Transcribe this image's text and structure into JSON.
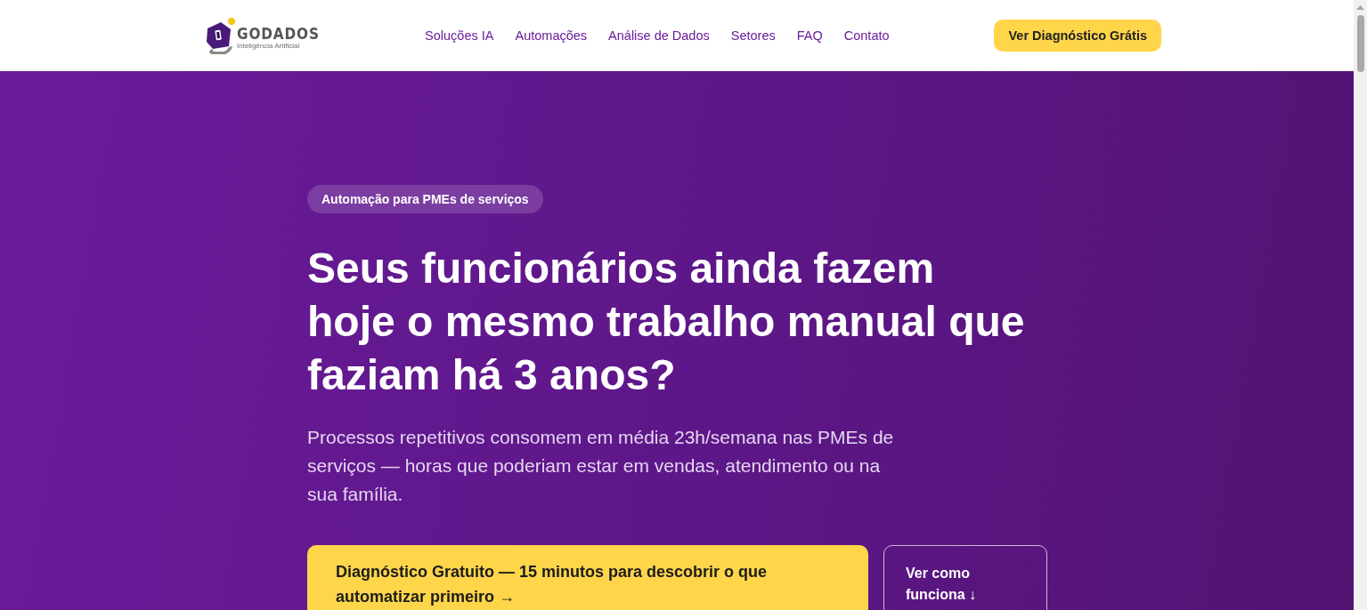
{
  "header": {
    "logo": {
      "name": "GODADOS",
      "tagline": "Inteligência Artificial"
    },
    "nav": [
      "Soluções IA",
      "Automações",
      "Análise de Dados",
      "Setores",
      "FAQ",
      "Contato"
    ],
    "cta": "Ver Diagnóstico Grátis"
  },
  "hero": {
    "badge": "Automação para PMEs de serviços",
    "heading": "Seus funcionários ainda fazem hoje o mesmo trabalho manual que faziam há 3 anos?",
    "lead": "Processos repetitivos consomem em média 23h/semana nas PMEs de serviços — horas que poderiam estar em vendas, atendimento ou na sua família.",
    "buttons": [
      {
        "kind": "primary",
        "label": "Diagnóstico Gratuito — 15 minutos para descobrir o que automatizar primeiro →"
      },
      {
        "kind": "secondary",
        "label": "Ver como funciona ↓"
      }
    ]
  }
}
